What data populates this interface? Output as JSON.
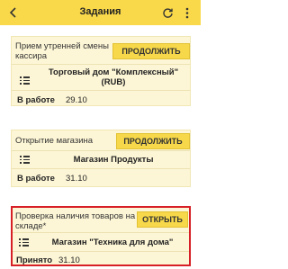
{
  "header": {
    "title": "Задания"
  },
  "cards": [
    {
      "title": "Прием утренней смены кассира",
      "button": "ПРОДОЛЖИТЬ",
      "store": "Торговый дом \"Комплексный\" (RUB)",
      "status": "В работе",
      "date": "29.10"
    },
    {
      "title": "Открытие магазина",
      "button": "ПРОДОЛЖИТЬ",
      "store": "Магазин Продукты",
      "status": "В работе",
      "date": "31.10"
    },
    {
      "title": "Проверка наличия товаров на складе*",
      "button": "ОТКРЫТЬ",
      "store": "Магазин \"Техника для дома\"",
      "status": "Принято",
      "date": "31.10"
    }
  ],
  "icons": {
    "back": "chevron-left-icon",
    "refresh": "refresh-icon",
    "more": "more-vertical-icon",
    "list": "list-icon"
  },
  "colors": {
    "header": "#f9d94a",
    "card": "#fdf6d6",
    "button": "#f7d84a",
    "highlight_border": "#d61f26"
  }
}
